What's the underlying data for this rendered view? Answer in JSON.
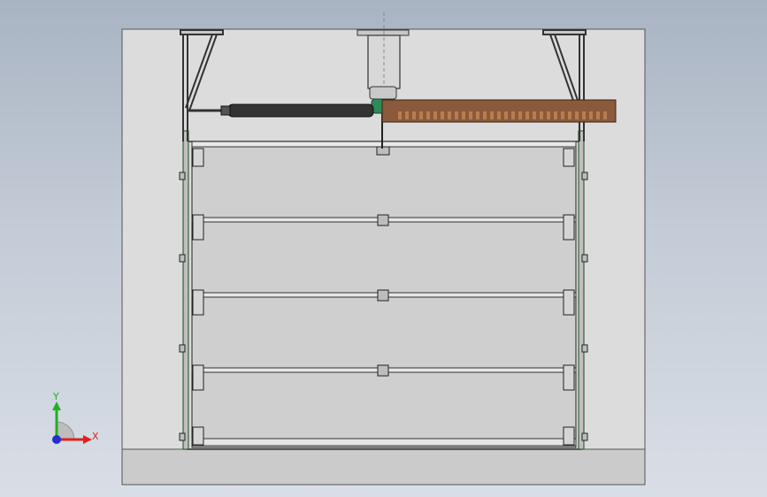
{
  "viewport": {
    "background_top": "#a9b4c3",
    "background_bottom": "#d9dee6"
  },
  "scene": {
    "wall_color": "#dcdcdc",
    "floor_color": "#cbcbcb",
    "door_panel_color": "#cfcfcf",
    "rail_color": "#8a5a3a",
    "shaft_color": "#333333",
    "motor_color": "#2e8b57",
    "panel_count": 4
  },
  "triad": {
    "x_label": "X",
    "y_label": "Y",
    "x_color": "#e02020",
    "y_color": "#20b020",
    "z_color": "#2030d0"
  }
}
